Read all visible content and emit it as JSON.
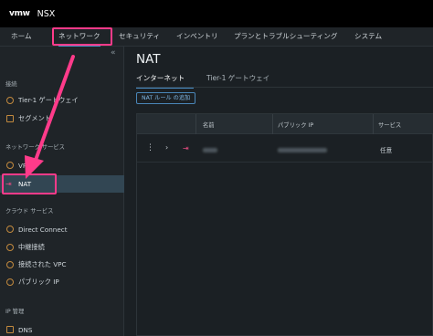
{
  "header": {
    "logo": "vmw",
    "title": "NSX"
  },
  "nav": {
    "items": [
      "ホーム",
      "ネットワーク",
      "セキュリティ",
      "インベントリ",
      "プランとトラブルシューティング",
      "システム"
    ],
    "active": "ネットワーク"
  },
  "sidebar": {
    "collapse_glyph": "«",
    "sections": [
      {
        "header": "接続",
        "items": [
          "Tier-1 ゲートウェイ",
          "セグメント"
        ]
      },
      {
        "header": "ネットワーク サービス",
        "items": [
          "VPN",
          "NAT"
        ]
      },
      {
        "header": "クラウド サービス",
        "items": [
          "Direct Connect",
          "中継接続",
          "接続された VPC",
          "パブリック IP"
        ]
      },
      {
        "header": "IP 管理",
        "items": [
          "DNS"
        ]
      }
    ],
    "active_item": "NAT"
  },
  "main": {
    "title": "NAT",
    "tabs": [
      "インターネット",
      "Tier-1 ゲートウェイ"
    ],
    "add_button": "NAT ルール の追加",
    "table": {
      "columns": [
        "名前",
        "パブリック IP",
        "サービス"
      ],
      "rows": [
        {
          "service": "任意"
        }
      ]
    }
  },
  "colors": {
    "highlight": "#ff3b8a",
    "accent": "#4a90c9",
    "nat_icon": "#e34b7f",
    "sidebar_icon": "#c38a3e"
  },
  "icons": {
    "kebab": "⋮",
    "expand": "›",
    "nat_rule": "⇥"
  }
}
